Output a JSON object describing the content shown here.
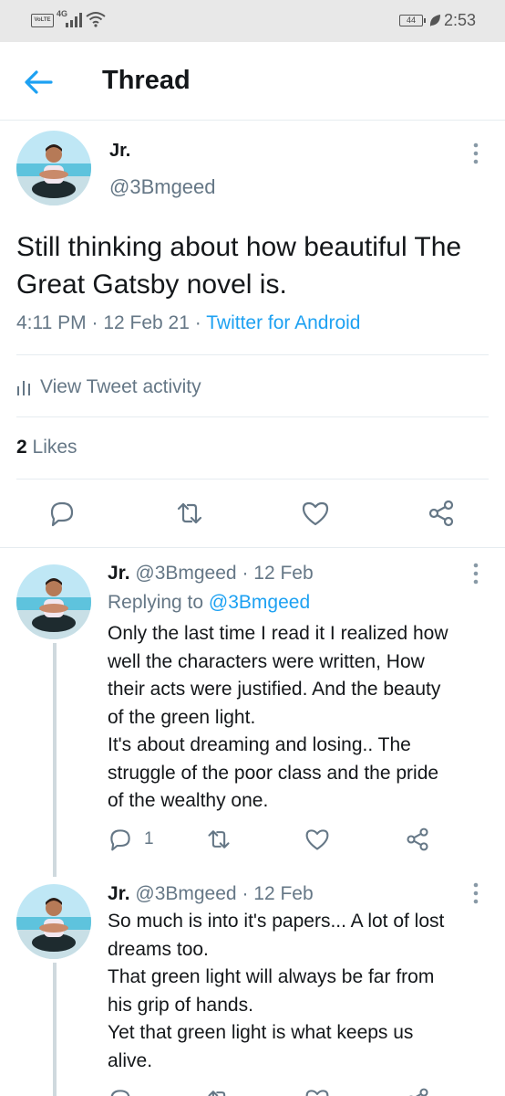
{
  "status_bar": {
    "volte": "VoLTE",
    "network": "4G",
    "battery": "44",
    "time": "2:53"
  },
  "header": {
    "title": "Thread",
    "back_icon": "arrow-left-icon"
  },
  "main_tweet": {
    "name": "Jr.",
    "handle": "@3Bmgeed",
    "text": "Still thinking about how beautiful The Great Gatsby novel is.",
    "time": "4:11 PM",
    "date": "12 Feb 21",
    "source": "Twitter for Android",
    "separator": "·",
    "activity_label": "View Tweet activity",
    "likes_count": "2",
    "likes_label": "Likes"
  },
  "replies": [
    {
      "name": "Jr.",
      "handle": "@3Bmgeed",
      "separator": "·",
      "date": "12 Feb",
      "replying_label": "Replying to",
      "replying_to": "@3Bmgeed",
      "lines": [
        "Only the last time I read it I realized how",
        "well the characters were written, How",
        "their acts were justified. And the beauty",
        "of the green light.",
        "It's about dreaming and losing.. The",
        "struggle of the poor class and the pride",
        "of the wealthy one."
      ],
      "reply_count": "1"
    },
    {
      "name": "Jr.",
      "handle": "@3Bmgeed",
      "separator": "·",
      "date": "12 Feb",
      "lines": [
        "So much is into it's papers... A lot of lost",
        "dreams too.",
        "That green light will always be far from",
        "his grip of hands.",
        "Yet that green light is what keeps us",
        "alive."
      ]
    }
  ],
  "colors": {
    "accent": "#1da1f2",
    "secondary_text": "#657786",
    "primary_text": "#14171a",
    "divider": "#e6ecf0"
  }
}
